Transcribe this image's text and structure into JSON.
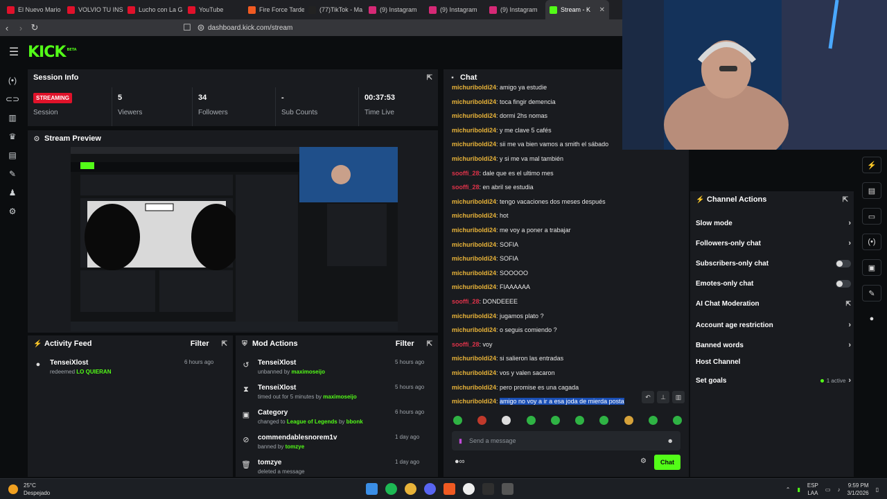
{
  "browser": {
    "tabs": [
      {
        "label": "El Nuevo Mario",
        "color": "#e0112b"
      },
      {
        "label": "VOLVIO TU INS",
        "color": "#e0112b"
      },
      {
        "label": "Lucho con La G",
        "color": "#e0112b"
      },
      {
        "label": "YouTube",
        "color": "#e0112b"
      },
      {
        "label": "Fire Force Tarde",
        "color": "#f05a22"
      },
      {
        "label": "(77)TikTok - Ma",
        "color": "#222222"
      },
      {
        "label": "(9) Instagram",
        "color": "#d62976"
      },
      {
        "label": "(9) Instagram",
        "color": "#d62976"
      },
      {
        "label": "(9) Instagram",
        "color": "#d62976"
      },
      {
        "label": "Stream - K",
        "color": "#53fc18"
      }
    ],
    "url": "dashboard.kick.com/stream"
  },
  "header": {
    "logo": "KICK",
    "logo_sup": "BETA"
  },
  "session": {
    "title": "Session Info",
    "badge": "STREAMING",
    "session_label": "Session",
    "viewers": "5",
    "viewers_label": "Viewers",
    "followers": "34",
    "followers_label": "Followers",
    "subs": "-",
    "subs_label": "Sub Counts",
    "time": "00:37:53",
    "time_label": "Time Live"
  },
  "preview": {
    "title": "Stream Preview"
  },
  "activity": {
    "title": "Activity Feed",
    "filter": "Filter",
    "items": [
      {
        "name": "TenseiXlost",
        "sub_prefix": "redeemed",
        "sub_value": "LO QUIERAN",
        "time": "6 hours ago"
      }
    ]
  },
  "mod": {
    "title": "Mod Actions",
    "filter": "Filter",
    "items": [
      {
        "name": "TenseiXlost",
        "sub_prefix": "unbanned by",
        "sub_value": "maximoseijo",
        "time": "5 hours ago",
        "icon": "↺"
      },
      {
        "name": "TenseiXlost",
        "sub_prefix": "timed out for 5 minutes by",
        "sub_value": "maximoseijo",
        "time": "5 hours ago",
        "icon": "⧗"
      },
      {
        "name": "Category",
        "sub_prefix": "changed to",
        "sub_value": "League of Legends",
        "sub_suffix": "by",
        "sub_value2": "bbonk",
        "time": "6 hours ago",
        "icon": "▣"
      },
      {
        "name": "commendablesnorem1v",
        "sub_prefix": "banned by",
        "sub_value": "tomzye",
        "time": "1 day ago",
        "icon": "⊘"
      },
      {
        "name": "tomzye",
        "sub_prefix": "deleted a message",
        "sub_value": "",
        "time": "1 day ago",
        "icon": "🗑"
      }
    ]
  },
  "chat": {
    "title": "Chat",
    "messages": [
      {
        "user": "michuriboldi24",
        "text": "amigo ya estudie",
        "c": "y"
      },
      {
        "user": "michuriboldi24",
        "text": "toca fingir demencia",
        "c": "y"
      },
      {
        "user": "michuriboldi24",
        "text": "dormi 2hs nomas",
        "c": "y"
      },
      {
        "user": "michuriboldi24",
        "text": "y me clave 5 cafés",
        "c": "y"
      },
      {
        "user": "michuriboldi24",
        "text": "sii me va bien vamos a smith el sábado",
        "c": "y"
      },
      {
        "user": "michuriboldi24",
        "text": "y si me va mal también",
        "c": "y"
      },
      {
        "user": "sooffi_28",
        "text": "dale que es el ultimo mes",
        "c": "r"
      },
      {
        "user": "sooffi_28",
        "text": "en abril se estudia",
        "c": "r"
      },
      {
        "user": "michuriboldi24",
        "text": "tengo vacaciones dos meses después",
        "c": "y"
      },
      {
        "user": "michuriboldi24",
        "text": "hot",
        "c": "y"
      },
      {
        "user": "michuriboldi24",
        "text": "me voy a poner a trabajar",
        "c": "y"
      },
      {
        "user": "michuriboldi24",
        "text": "SOFIA",
        "c": "y"
      },
      {
        "user": "michuriboldi24",
        "text": "SOFIA",
        "c": "y"
      },
      {
        "user": "michuriboldi24",
        "text": "SOOOOO",
        "c": "y"
      },
      {
        "user": "michuriboldi24",
        "text": "FIAAAAAA",
        "c": "y"
      },
      {
        "user": "sooffi_28",
        "text": "DONDEEEE",
        "c": "r"
      },
      {
        "user": "michuriboldi24",
        "text": "jugamos plato ?",
        "c": "y"
      },
      {
        "user": "michuriboldi24",
        "text": "o seguis comiendo ?",
        "c": "y"
      },
      {
        "user": "sooffi_28",
        "text": "voy",
        "c": "r"
      },
      {
        "user": "michuriboldi24",
        "text": "si salieron las entradas",
        "c": "y"
      },
      {
        "user": "michuriboldi24",
        "text": "vos y valen sacaron",
        "c": "y"
      },
      {
        "user": "michuriboldi24",
        "text": "pero promise es una cagada",
        "c": "y"
      },
      {
        "user": "michuriboldi24",
        "text": "amigo no voy a ir a esa joda de mierda posta",
        "c": "y",
        "selected": true
      }
    ],
    "placeholder": "Send a message",
    "send_label": "Chat"
  },
  "channel_actions": {
    "title": "Channel Actions",
    "items": [
      {
        "label": "Slow mode",
        "control": "chevron"
      },
      {
        "label": "Followers-only chat",
        "control": "chevron"
      },
      {
        "label": "Subscribers-only chat",
        "control": "toggle"
      },
      {
        "label": "Emotes-only chat",
        "control": "toggle"
      },
      {
        "label": "AI Chat Moderation",
        "control": "external"
      },
      {
        "label": "Account age restriction",
        "control": "chevron"
      },
      {
        "label": "Banned words",
        "control": "chevron"
      },
      {
        "label": "Host Channel",
        "control": "none"
      },
      {
        "label": "Set goals",
        "control": "active",
        "extra": "1 active"
      }
    ]
  },
  "taskbar": {
    "temp": "25°C",
    "weather": "Despejado",
    "lang1": "ESP",
    "lang2": "LAA",
    "time": "9:59 PM",
    "date": "3/1/2026"
  }
}
